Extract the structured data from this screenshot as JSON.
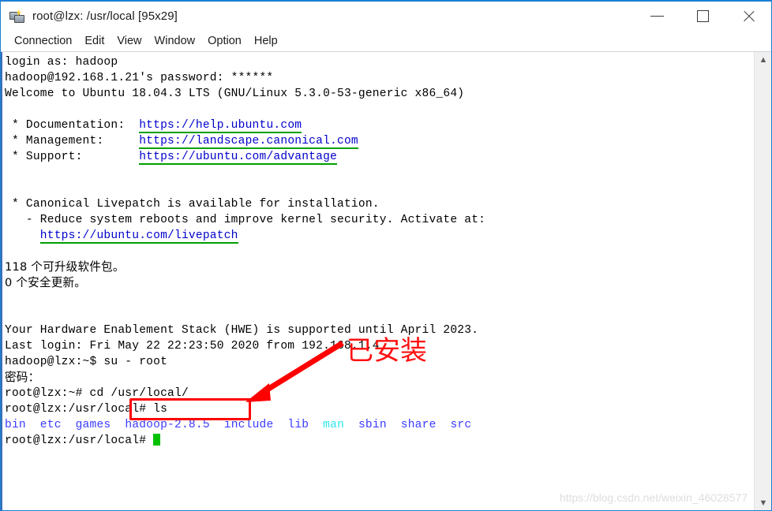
{
  "window": {
    "title": "root@lzx: /usr/local [95x29]",
    "icon": "network-computer-icon",
    "accent_color": "#1a7fd4",
    "controls": {
      "minimize": "—",
      "maximize": "□",
      "close": "✕"
    }
  },
  "menubar": {
    "items": [
      {
        "label": "Connection"
      },
      {
        "label": "Edit"
      },
      {
        "label": "View"
      },
      {
        "label": "Window"
      },
      {
        "label": "Option"
      },
      {
        "label": "Help"
      }
    ]
  },
  "terminal": {
    "lines": [
      {
        "segments": [
          {
            "text": "login as: hadoop"
          }
        ]
      },
      {
        "segments": [
          {
            "text": "hadoop@192.168.1.21's password: ******"
          }
        ]
      },
      {
        "segments": [
          {
            "text": "Welcome to Ubuntu 18.04.3 LTS (GNU/Linux 5.3.0-53-generic x86_64)"
          }
        ]
      },
      {
        "segments": [
          {
            "text": ""
          }
        ]
      },
      {
        "segments": [
          {
            "text": " * Documentation:  "
          },
          {
            "text": "https://help.ubuntu.com",
            "style": "link"
          }
        ]
      },
      {
        "segments": [
          {
            "text": " * Management:     "
          },
          {
            "text": "https://landscape.canonical.com",
            "style": "link"
          }
        ]
      },
      {
        "segments": [
          {
            "text": " * Support:        "
          },
          {
            "text": "https://ubuntu.com/advantage",
            "style": "link"
          }
        ]
      },
      {
        "segments": [
          {
            "text": ""
          }
        ]
      },
      {
        "segments": [
          {
            "text": ""
          }
        ]
      },
      {
        "segments": [
          {
            "text": " * Canonical Livepatch is available for installation."
          }
        ]
      },
      {
        "segments": [
          {
            "text": "   - Reduce system reboots and improve kernel security. Activate at:"
          }
        ]
      },
      {
        "segments": [
          {
            "text": "     "
          },
          {
            "text": "https://ubuntu.com/livepatch",
            "style": "link"
          }
        ]
      },
      {
        "segments": [
          {
            "text": ""
          }
        ]
      },
      {
        "cjk": true,
        "segments": [
          {
            "text": "118 个可升级软件包。"
          }
        ]
      },
      {
        "cjk": true,
        "segments": [
          {
            "text": "0 个安全更新。"
          }
        ]
      },
      {
        "segments": [
          {
            "text": ""
          }
        ]
      },
      {
        "segments": [
          {
            "text": ""
          }
        ]
      },
      {
        "segments": [
          {
            "text": "Your Hardware Enablement Stack (HWE) is supported until April 2023."
          }
        ]
      },
      {
        "segments": [
          {
            "text": "Last login: Fri May 22 22:23:50 2020 from 192.168.1.4"
          }
        ]
      },
      {
        "segments": [
          {
            "text": "hadoop@lzx:~$ su - root"
          }
        ]
      },
      {
        "cjk": true,
        "segments": [
          {
            "text": "密码："
          }
        ]
      },
      {
        "segments": [
          {
            "text": "root@lzx:~# cd /usr/local/"
          }
        ]
      },
      {
        "segments": [
          {
            "text": "root@lzx:/usr/local# ls"
          }
        ]
      },
      {
        "segments": [
          {
            "text": "bin",
            "style": "dir"
          },
          {
            "text": "  "
          },
          {
            "text": "etc",
            "style": "dir"
          },
          {
            "text": "  "
          },
          {
            "text": "games",
            "style": "dir"
          },
          {
            "text": "  "
          },
          {
            "text": "hadoop-2.8.5",
            "style": "dir"
          },
          {
            "text": "  "
          },
          {
            "text": "include",
            "style": "dir"
          },
          {
            "text": "  "
          },
          {
            "text": "lib",
            "style": "dir"
          },
          {
            "text": "  "
          },
          {
            "text": "man",
            "style": "symlink"
          },
          {
            "text": "  "
          },
          {
            "text": "sbin",
            "style": "dir"
          },
          {
            "text": "  "
          },
          {
            "text": "share",
            "style": "dir"
          },
          {
            "text": "  "
          },
          {
            "text": "src",
            "style": "dir"
          }
        ]
      },
      {
        "segments": [
          {
            "text": "root@lzx:/usr/local# "
          },
          {
            "style": "cursor"
          }
        ]
      }
    ]
  },
  "annotations": {
    "highlight_target": "hadoop-2.8.5",
    "label": "已安装",
    "color": "#ff0000"
  },
  "watermark": {
    "text": "https://blog.csdn.net/weixin_46028577"
  }
}
